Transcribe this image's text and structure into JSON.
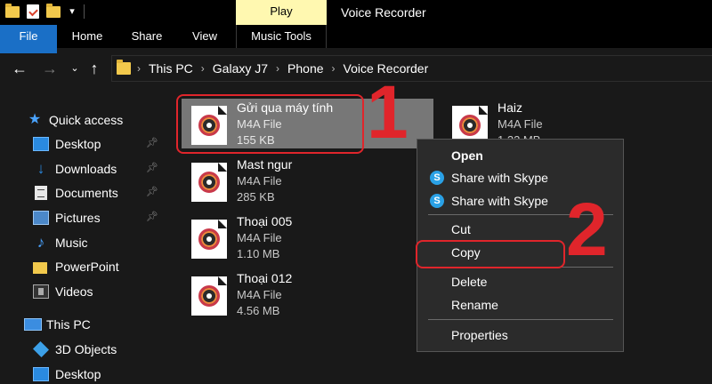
{
  "titlebar": {
    "title": "Voice Recorder",
    "contextual_tab": "Play"
  },
  "ribbon": {
    "tabs": [
      "File",
      "Home",
      "Share",
      "View",
      "Music Tools"
    ]
  },
  "address": {
    "crumbs": [
      "This PC",
      "Galaxy J7",
      "Phone",
      "Voice Recorder"
    ]
  },
  "sidebar": {
    "items": [
      {
        "label": "Quick access",
        "icon": "star-icon"
      },
      {
        "label": "Desktop",
        "icon": "desktop-icon",
        "pinned": true
      },
      {
        "label": "Downloads",
        "icon": "download-icon",
        "pinned": true
      },
      {
        "label": "Documents",
        "icon": "document-icon",
        "pinned": true
      },
      {
        "label": "Pictures",
        "icon": "pictures-icon",
        "pinned": true
      },
      {
        "label": "Music",
        "icon": "music-icon"
      },
      {
        "label": "PowerPoint",
        "icon": "folder-icon"
      },
      {
        "label": "Videos",
        "icon": "video-icon"
      },
      {
        "label": "This PC",
        "icon": "computer-icon"
      },
      {
        "label": "3D Objects",
        "icon": "3d-objects-icon"
      },
      {
        "label": "Desktop",
        "icon": "desktop-icon"
      }
    ]
  },
  "files": [
    {
      "name": "Gửi qua máy tính",
      "type": "M4A File",
      "size": "155 KB",
      "selected": true
    },
    {
      "name": "Haiz",
      "type": "M4A File",
      "size": "1.22 MB"
    },
    {
      "name": "Mast ngur",
      "type": "M4A File",
      "size": "285 KB"
    },
    {
      "name": "Thoại 005",
      "type": "M4A File",
      "size": "1.10 MB"
    },
    {
      "name": "Thoại 012",
      "type": "M4A File",
      "size": "4.56 MB"
    }
  ],
  "context_menu": {
    "items": [
      "Open",
      "Share with Skype",
      "Share with Skype",
      "Cut",
      "Copy",
      "Delete",
      "Rename",
      "Properties"
    ]
  },
  "annotations": {
    "step1": "1",
    "step2": "2",
    "color": "#e0252b"
  },
  "colors": {
    "background": "#191919",
    "file_tab": "#1a6fc6",
    "play_tab": "#fff8b0",
    "selection": "#777777"
  }
}
